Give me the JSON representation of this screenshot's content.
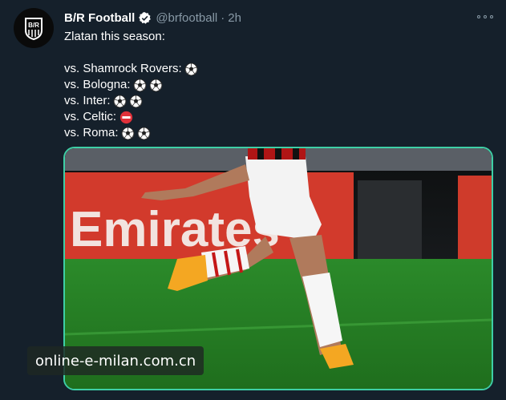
{
  "account": {
    "display_name": "B/R Football",
    "handle": "@brfootball",
    "separator": "·",
    "timestamp": "2h",
    "avatar_icon": "br-logo-icon",
    "verified_icon": "verified-badge-icon"
  },
  "tweet": {
    "intro": "Zlatan this season:",
    "lines": [
      {
        "label": "vs. Shamrock Rovers:",
        "icons": [
          "soccer-ball"
        ]
      },
      {
        "label": "vs. Bologna:",
        "icons": [
          "soccer-ball",
          "soccer-ball"
        ]
      },
      {
        "label": "vs. Inter:",
        "icons": [
          "soccer-ball",
          "soccer-ball"
        ]
      },
      {
        "label": "vs. Celtic:",
        "icons": [
          "no-entry"
        ]
      },
      {
        "label": "vs. Roma:",
        "icons": [
          "soccer-ball",
          "soccer-ball"
        ]
      }
    ]
  },
  "media": {
    "description_icon": "photo-icon",
    "banner_text": "Emirates"
  },
  "watermark": {
    "text": "online-e-milan.com.cn"
  },
  "colors": {
    "background": "#15202b",
    "secondary_text": "#8899a6",
    "media_border": "#3ecfa6",
    "verified": "#ffffff"
  }
}
